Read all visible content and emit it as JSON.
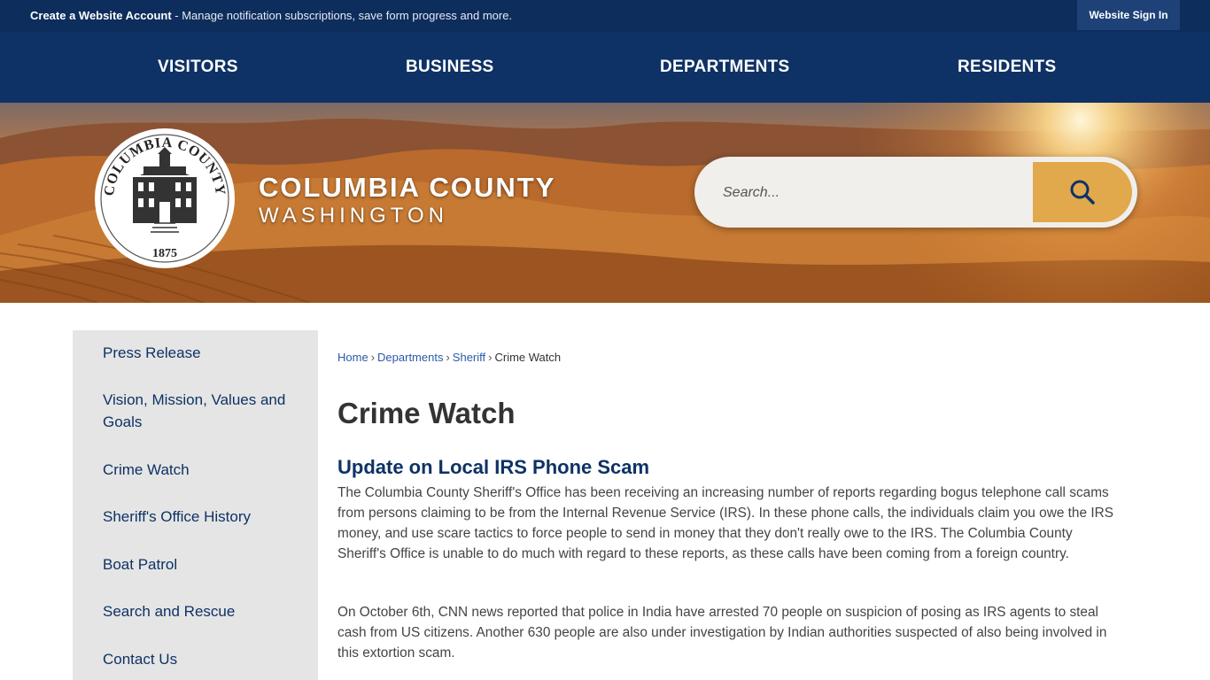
{
  "topbar": {
    "account_link": "Create a Website Account",
    "account_text": " - Manage notification subscriptions, save form progress and more.",
    "sign_in": "Website Sign In"
  },
  "nav": [
    "VISITORS",
    "BUSINESS",
    "DEPARTMENTS",
    "RESIDENTS"
  ],
  "banner": {
    "county": "COLUMBIA COUNTY",
    "state": "WASHINGTON",
    "seal_top": "COLUMBIA COUNTY",
    "seal_year": "1875",
    "search_placeholder": "Search..."
  },
  "sidebar": {
    "items": [
      "Press Release",
      "Vision, Mission, Values and Goals",
      "Crime Watch",
      "Sheriff's Office History",
      "Boat Patrol",
      "Search and Rescue",
      "Contact Us"
    ]
  },
  "breadcrumb": {
    "home": "Home",
    "departments": "Departments",
    "sheriff": "Sheriff",
    "current": "Crime Watch",
    "sep": "›"
  },
  "main": {
    "title": "Crime Watch",
    "article_title": "Update on Local IRS Phone Scam",
    "paragraph1": "The Columbia County Sheriff's Office has been receiving an increasing number of reports regarding bogus telephone call scams from persons claiming to be from the Internal Revenue Service (IRS). In these phone calls, the individuals claim you owe the IRS money, and use scare tactics to force people to send in money that they don't really owe to the IRS. The Columbia County Sheriff's Office is unable to do much with regard to these reports, as these calls have been coming from a foreign country.",
    "paragraph2": "On October 6th, CNN news reported that police in India have arrested 70 people on suspicion of posing as IRS agents to steal cash from US citizens. Another 630 people are also under investigation by Indian authorities suspected of also being involved in this extortion scam."
  },
  "colors": {
    "navy": "#0e3265",
    "topbar": "#0d2d5c",
    "sidebar": "#e5e5e5",
    "search_button": "#e1a84c",
    "link": "#2a5ba8"
  },
  "icons": {
    "search_button": "search-icon",
    "seal": "courthouse-seal"
  }
}
